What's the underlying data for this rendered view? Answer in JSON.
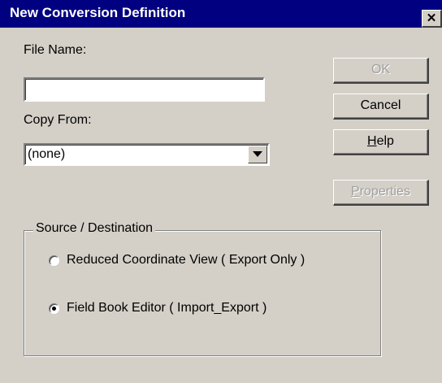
{
  "window": {
    "title": "New Conversion Definition",
    "close_glyph": "✕"
  },
  "file_name": {
    "label": "File Name:",
    "value": ""
  },
  "copy_from": {
    "label": "Copy From:",
    "value": "(none)"
  },
  "buttons": {
    "ok": {
      "label": "OK",
      "enabled": false
    },
    "cancel": {
      "label": "Cancel",
      "enabled": true
    },
    "help": {
      "label_pre": "",
      "label_mnemonic": "H",
      "label_post": "elp",
      "enabled": true
    },
    "properties": {
      "label_pre": "",
      "label_mnemonic": "P",
      "label_post": "roperties",
      "enabled": false
    }
  },
  "source_destination": {
    "legend": "Source / Destination",
    "options": [
      {
        "label": "Reduced Coordinate View ( Export Only )",
        "selected": false
      },
      {
        "label": "Field Book Editor ( Import_Export )",
        "selected": true
      }
    ]
  }
}
